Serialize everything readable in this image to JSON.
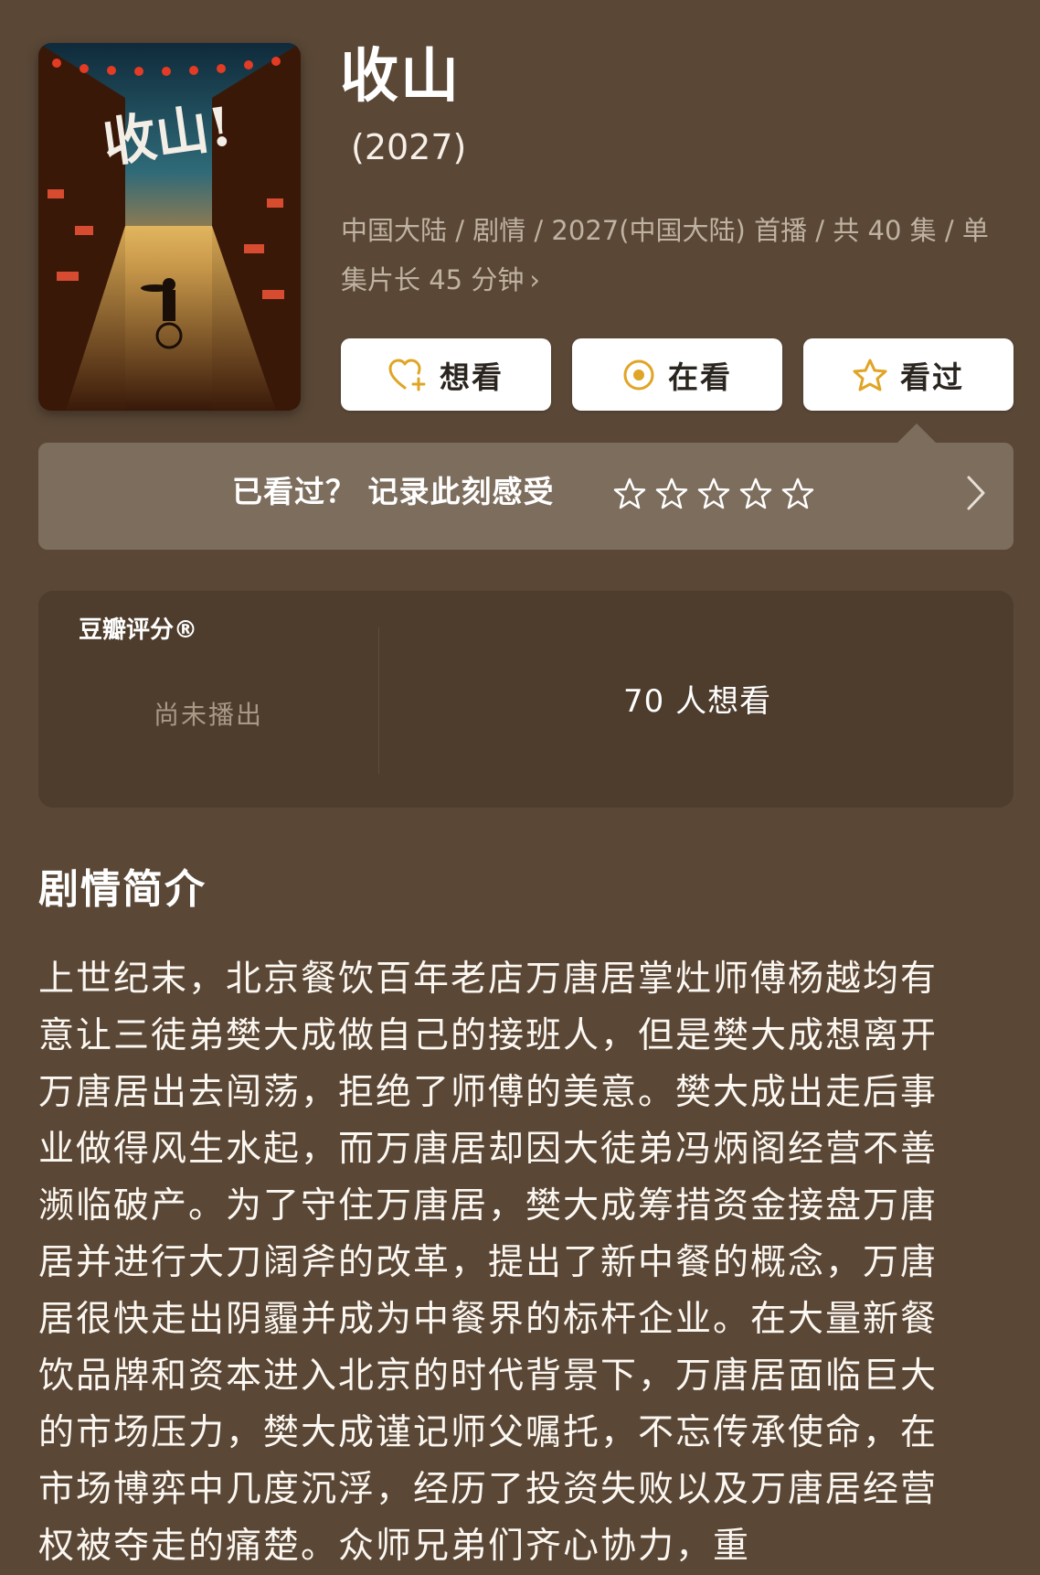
{
  "show": {
    "title": "收山",
    "year": "(2027)",
    "meta_line_1": "中国大陆 / 剧情 / 2027(中国大陆) 首播 / 共 40 集 / 单",
    "meta_line_2": "集片长 45 分钟",
    "meta_chevron": "›",
    "poster_text": "收山!"
  },
  "actions": {
    "want_label": "想看",
    "watching_label": "在看",
    "watched_label": "看过"
  },
  "rating_prompt": {
    "text": "已看过？ 记录此刻感受",
    "stars_total": 5,
    "stars_filled": 0
  },
  "douban_score": {
    "title": "豆瓣评分®",
    "status": "尚未播出",
    "want_count_text": "70 人想看"
  },
  "synopsis": {
    "heading": "剧情简介",
    "lines": [
      "上世纪末，北京餐饮百年老店万唐居掌灶师傅杨越均有",
      "意让三徒弟樊大成做自己的接班人，但是樊大成想离开",
      "万唐居出去闯荡，拒绝了师傅的美意。樊大成出走后事",
      "业做得风生水起，而万唐居却因大徒弟冯炳阁经营不善",
      "濒临破产。为了守住万唐居，樊大成筹措资金接盘万唐",
      "居并进行大刀阔斧的改革，提出了新中餐的概念，万唐",
      "居很快走出阴霾并成为中餐界的标杆企业。在大量新餐",
      "饮品牌和资本进入北京的时代背景下，万唐居面临巨大",
      "的市场压力，樊大成谨记师父嘱托，不忘传承使命，在",
      "市场博弈中几度沉浮，经历了投资失败以及万唐居经营",
      "权被夺走的痛楚。众师兄弟们齐心协力，重"
    ]
  },
  "colors": {
    "background": "#5a4736",
    "rate_bar": "#7d6d5d",
    "score_card": "#4e3d2d",
    "button_bg": "#ffffff",
    "icon_gold": "#e0a526"
  }
}
